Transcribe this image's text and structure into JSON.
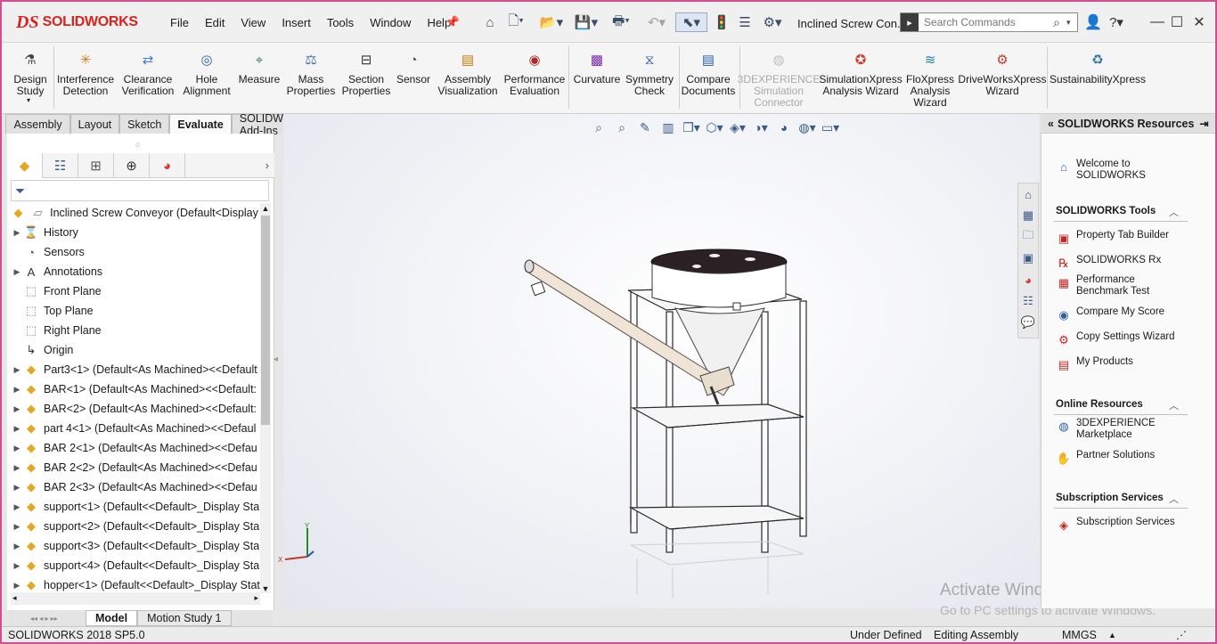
{
  "app": {
    "brand_mark": "DS",
    "brand": "SOLIDWORKS",
    "document_title": "Inclined Screw Con...",
    "version": "SOLIDWORKS 2018 SP5.0"
  },
  "menu": [
    "File",
    "Edit",
    "View",
    "Insert",
    "Tools",
    "Window",
    "Help"
  ],
  "search": {
    "placeholder": "Search Commands"
  },
  "commands": [
    {
      "label": "Design\nStudy",
      "icon": "design-study-icon",
      "disabled": false
    },
    {
      "label": "Interference\nDetection",
      "icon": "interference-detection-icon",
      "disabled": false
    },
    {
      "label": "Clearance\nVerification",
      "icon": "clearance-verification-icon",
      "disabled": false
    },
    {
      "label": "Hole\nAlignment",
      "icon": "hole-alignment-icon",
      "disabled": false
    },
    {
      "label": "Measure",
      "icon": "measure-icon",
      "disabled": false
    },
    {
      "label": "Mass\nProperties",
      "icon": "mass-properties-icon",
      "disabled": false
    },
    {
      "label": "Section\nProperties",
      "icon": "section-properties-icon",
      "disabled": false
    },
    {
      "label": "Sensor",
      "icon": "sensor-icon",
      "disabled": false
    },
    {
      "label": "Assembly\nVisualization",
      "icon": "assembly-visualization-icon",
      "disabled": false
    },
    {
      "label": "Performance\nEvaluation",
      "icon": "performance-evaluation-icon",
      "disabled": false
    },
    {
      "label": "Curvature",
      "icon": "curvature-icon",
      "disabled": false
    },
    {
      "label": "Symmetry\nCheck",
      "icon": "symmetry-check-icon",
      "disabled": false
    },
    {
      "label": "Compare\nDocuments",
      "icon": "compare-documents-icon",
      "disabled": false
    },
    {
      "label": "3DEXPERIENCE\nSimulation\nConnector",
      "icon": "3dexperience-icon",
      "disabled": true
    },
    {
      "label": "SimulationXpress\nAnalysis Wizard",
      "icon": "simulationxpress-icon",
      "disabled": false
    },
    {
      "label": "FloXpress\nAnalysis\nWizard",
      "icon": "floxpress-icon",
      "disabled": false
    },
    {
      "label": "DriveWorksXpress\nWizard",
      "icon": "driveworksxpress-icon",
      "disabled": false
    },
    {
      "label": "SustainabilityXpress",
      "icon": "sustainabilityxpress-icon",
      "disabled": false
    }
  ],
  "tabs": [
    {
      "label": "Assembly",
      "active": false
    },
    {
      "label": "Layout",
      "active": false
    },
    {
      "label": "Sketch",
      "active": false
    },
    {
      "label": "Evaluate",
      "active": true
    },
    {
      "label": "SOLIDWORKS Add-Ins",
      "active": false
    }
  ],
  "tree": {
    "root": "Inclined Screw Conveyor  (Default<Display St",
    "items": [
      {
        "label": "History",
        "kind": "history",
        "expandable": true
      },
      {
        "label": "Sensors",
        "kind": "sensor",
        "expandable": false
      },
      {
        "label": "Annotations",
        "kind": "annotation",
        "expandable": true
      },
      {
        "label": "Front Plane",
        "kind": "plane",
        "expandable": false
      },
      {
        "label": "Top Plane",
        "kind": "plane",
        "expandable": false
      },
      {
        "label": "Right Plane",
        "kind": "plane",
        "expandable": false
      },
      {
        "label": "Origin",
        "kind": "origin",
        "expandable": false
      },
      {
        "label": "Part3<1> (Default<As Machined><<Default",
        "kind": "part",
        "expandable": true
      },
      {
        "label": "BAR<1> (Default<As Machined><<Default:",
        "kind": "part",
        "expandable": true
      },
      {
        "label": "BAR<2> (Default<As Machined><<Default:",
        "kind": "part",
        "expandable": true
      },
      {
        "label": "part 4<1> (Default<As Machined><<Defaul",
        "kind": "part",
        "expandable": true
      },
      {
        "label": "BAR 2<1> (Default<As Machined><<Defau",
        "kind": "part",
        "expandable": true
      },
      {
        "label": "BAR 2<2> (Default<As Machined><<Defau",
        "kind": "part",
        "expandable": true
      },
      {
        "label": "BAR 2<3> (Default<As Machined><<Defau",
        "kind": "part",
        "expandable": true
      },
      {
        "label": "support<1> (Default<<Default>_Display Sta",
        "kind": "part",
        "expandable": true
      },
      {
        "label": "support<2> (Default<<Default>_Display Sta",
        "kind": "part",
        "expandable": true
      },
      {
        "label": "support<3> (Default<<Default>_Display Sta",
        "kind": "part",
        "expandable": true
      },
      {
        "label": "support<4> (Default<<Default>_Display Sta",
        "kind": "part",
        "expandable": true
      },
      {
        "label": "hopper<1> (Default<<Default>_Display Stat",
        "kind": "part",
        "expandable": true
      }
    ]
  },
  "bottom_tabs": [
    {
      "label": "Model",
      "active": true
    },
    {
      "label": "Motion Study 1",
      "active": false
    }
  ],
  "status": {
    "left": "SOLIDWORKS 2018 SP5.0",
    "definition": "Under Defined",
    "mode": "Editing Assembly",
    "units": "MMGS",
    "units_caret": "▲"
  },
  "triad": {
    "x": "X",
    "y": "Y"
  },
  "watermark": {
    "line1": "Activate Windows",
    "line2": "Go to PC settings to activate Windows."
  },
  "resources": {
    "title": "SOLIDWORKS Resources",
    "welcome": "Welcome to\nSOLIDWORKS",
    "sections": [
      {
        "title": "SOLIDWORKS Tools",
        "items": [
          {
            "label": "Property Tab Builder",
            "icon": "property-tab-builder-icon"
          },
          {
            "label": "SOLIDWORKS Rx",
            "icon": "solidworks-rx-icon"
          },
          {
            "label": "Performance\nBenchmark Test",
            "icon": "benchmark-icon"
          },
          {
            "label": "Compare My Score",
            "icon": "compare-score-icon"
          },
          {
            "label": "Copy Settings Wizard",
            "icon": "copy-settings-icon"
          },
          {
            "label": "My Products",
            "icon": "my-products-icon"
          }
        ]
      },
      {
        "title": "Online Resources",
        "items": [
          {
            "label": "3DEXPERIENCE\nMarketplace",
            "icon": "marketplace-icon"
          },
          {
            "label": "Partner Solutions",
            "icon": "partner-solutions-icon"
          }
        ]
      },
      {
        "title": "Subscription Services",
        "items": [
          {
            "label": "Subscription Services",
            "icon": "subscription-icon"
          }
        ]
      }
    ]
  }
}
